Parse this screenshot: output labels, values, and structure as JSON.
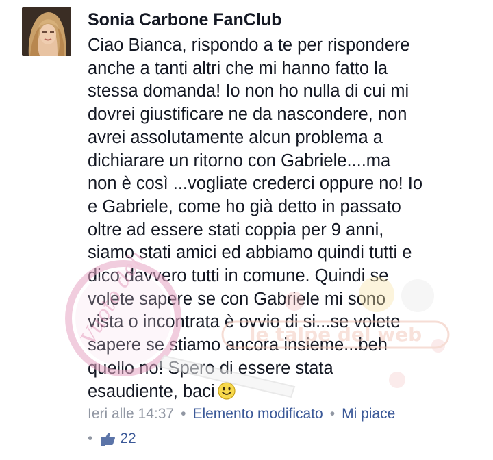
{
  "comment": {
    "author": "Sonia Carbone FanClub",
    "lines": [
      "Ciao Bianca, rispondo a te per rispondere",
      "anche a tanti altri che mi hanno fatto la",
      "stessa domanda! Io non ho nulla di cui mi",
      "dovrei giustificare ne da nascondere, non",
      "avrei assolutamente alcun problema a",
      "dichiarare un ritorno con Gabriele....ma",
      "non è così ...vogliate crederci oppure no! Io",
      "e Gabriele, come ho già detto in passato",
      "oltre ad essere stati coppia per 9 anni,",
      "siamo stati amici ed abbiamo quindi tutti e",
      "dico davvero tutti in comune. Quindi se",
      "volete sapere se con Gabriele mi sono",
      "vista o incontrata è ovvio di si...se volete",
      "sapere se stiamo ancora insieme...beh",
      "quello no! Spero di essere stata",
      "esaudiente, baci"
    ],
    "emoji": "smiley-emoji"
  },
  "meta": {
    "time": "Ieri alle 14:37",
    "edited": "Elemento modificato",
    "like": "Mi piace",
    "separator": "•"
  },
  "likes": {
    "count": "22",
    "icon": "thumbs-up-icon"
  },
  "watermark": {
    "brand": "le talpe del web",
    "script": "Vuoto delle Talpe"
  },
  "colors": {
    "text": "#141823",
    "meta": "#9197a3",
    "link": "#3b5998"
  }
}
